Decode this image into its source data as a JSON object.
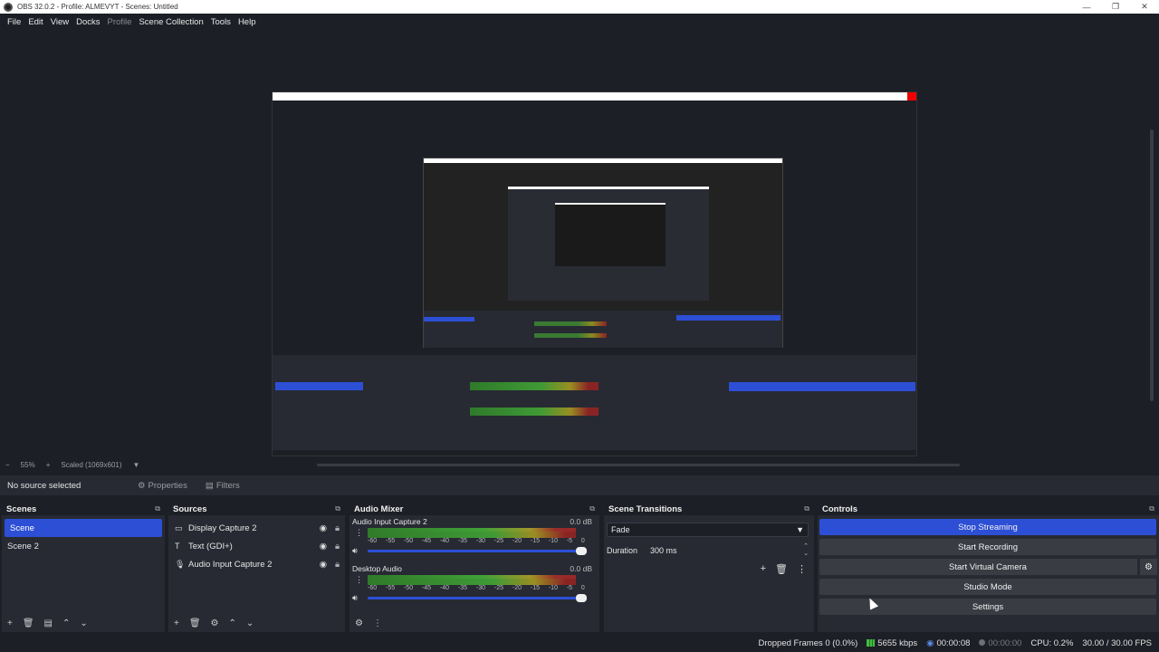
{
  "window": {
    "title": "OBS 32.0.2 - Profile: ALMEVYT - Scenes: Untitled",
    "minimize_icon": "—",
    "maximize_icon": "❐",
    "close_icon": "✕"
  },
  "menu": {
    "items": [
      "File",
      "Edit",
      "View",
      "Docks",
      "Profile",
      "Scene Collection",
      "Tools",
      "Help"
    ]
  },
  "zoom": {
    "minus": "−",
    "value": "55%",
    "plus": "+",
    "mode": "Scaled (1069x601)"
  },
  "source_toolbar": {
    "no_source": "No source selected",
    "properties_label": "Properties",
    "filters_label": "Filters"
  },
  "scenes": {
    "title": "Scenes",
    "items": [
      "Scene",
      "Scene 2"
    ],
    "active_index": 0
  },
  "sources": {
    "title": "Sources",
    "items": [
      {
        "name": "Display Capture 2",
        "icon": "monitor-icon"
      },
      {
        "name": "Text (GDI+)",
        "icon": "text-icon"
      },
      {
        "name": "Audio Input Capture 2",
        "icon": "microphone-icon"
      }
    ]
  },
  "audio_mixer": {
    "title": "Audio Mixer",
    "channels": [
      {
        "name": "Audio Input Capture 2",
        "db": "0.0 dB"
      },
      {
        "name": "Desktop Audio",
        "db": "0.0 dB"
      }
    ],
    "ticks": [
      "-60",
      "-55",
      "-50",
      "-45",
      "-40",
      "-35",
      "-30",
      "-25",
      "-20",
      "-15",
      "-10",
      "-5",
      "0"
    ]
  },
  "transitions": {
    "title": "Scene Transitions",
    "selected": "Fade",
    "duration_label": "Duration",
    "duration_value": "300 ms"
  },
  "controls": {
    "title": "Controls",
    "stop_streaming": "Stop Streaming",
    "start_recording": "Start Recording",
    "start_virtual_camera": "Start Virtual Camera",
    "studio_mode": "Studio Mode",
    "settings": "Settings"
  },
  "status": {
    "dropped_frames": "Dropped Frames 0 (0.0%)",
    "bitrate": "5655 kbps",
    "stream_time": "00:00:08",
    "record_time": "00:00:00",
    "cpu": "CPU: 0.2%",
    "fps": "30.00 / 30.00 FPS"
  },
  "colors": {
    "accent": "#2d4fd6",
    "panel": "#272a33",
    "background": "#1d1f26"
  }
}
